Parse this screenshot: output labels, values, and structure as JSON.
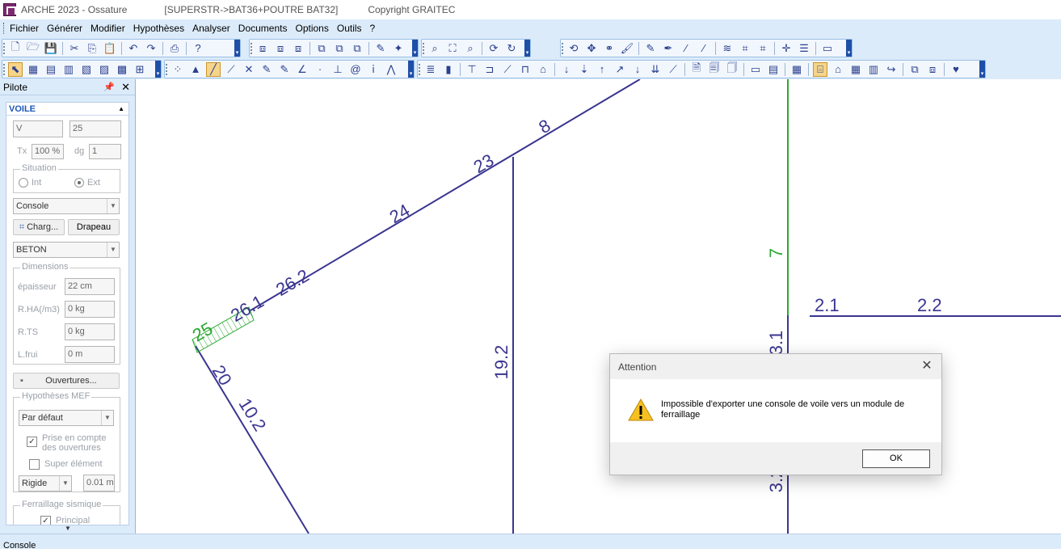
{
  "window": {
    "app_title": "ARCHE 2023 - Ossature",
    "project": "[SUPERSTR->BAT36+POUTRE BAT32]",
    "copyright": "Copyright GRAITEC"
  },
  "menu": [
    "Fichier",
    "Générer",
    "Modifier",
    "Hypothèses",
    "Analyser",
    "Documents",
    "Options",
    "Outils",
    "?"
  ],
  "pilot": {
    "title": "Pilote",
    "section": "VOILE",
    "name_field": "V",
    "number_field": "25",
    "tx_label": "Tx",
    "tx_value": "100 %",
    "dg_label": "dg",
    "dg_value": "1",
    "situation_label": "Situation",
    "situation_int": "Int",
    "situation_ext": "Ext",
    "type_combo": "Console",
    "charg_button": "Charg...",
    "drapeau_button": "Drapeau",
    "material_combo": "BETON",
    "dimensions_label": "Dimensions",
    "epaisseur_label": "épaisseur",
    "epaisseur_value": "22 cm",
    "rha_label": "R.HA(/m3)",
    "rha_value": "0 kg",
    "rts_label": "R.TS",
    "rts_value": "0 kg",
    "lfrui_label": "L.frui",
    "lfrui_value": "0 m",
    "ouvertures_button": "Ouvertures...",
    "mef_label": "Hypothèses MEF",
    "mef_combo": "Par défaut",
    "prise_compte": "Prise en compte des ouvertures",
    "super_element": "Super élément",
    "rigide_combo": "Rigide",
    "rigide_value": "0.01 m",
    "ferraillage_label": "Ferraillage sismique",
    "principal": "Principal"
  },
  "drawing": {
    "labels": [
      "8",
      "23",
      "24",
      "26.2",
      "26.1",
      "25",
      "20",
      "10.2",
      "19.2",
      "7",
      "2.1",
      "2.2",
      "3.1",
      "3.2"
    ],
    "colors": {
      "member": "#3a3590",
      "highlight": "#2aa830"
    }
  },
  "dialog": {
    "title": "Attention",
    "message": "Impossible d'exporter une console de voile vers un module de ferraillage",
    "ok": "OK"
  },
  "status": {
    "text": "Console"
  }
}
